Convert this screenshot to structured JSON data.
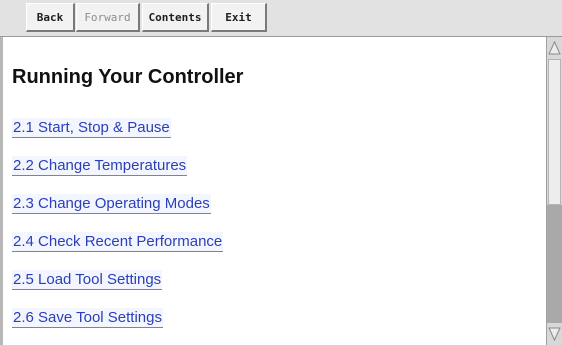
{
  "toolbar": {
    "back_label": "Back",
    "forward_label": "Forward",
    "contents_label": "Contents",
    "exit_label": "Exit"
  },
  "page": {
    "heading": "Running Your Controller",
    "links": [
      "2.1 Start, Stop & Pause",
      "2.2 Change Temperatures",
      "2.3 Change Operating Modes",
      "2.4 Check Recent Performance",
      "2.5 Load Tool Settings",
      "2.6 Save Tool Settings"
    ]
  },
  "icons": {
    "scroll_up": "triangle-up-icon",
    "scroll_down": "triangle-down-icon"
  },
  "colors": {
    "link": "#2a3fb8",
    "toolbar": "#e2e2e2"
  }
}
